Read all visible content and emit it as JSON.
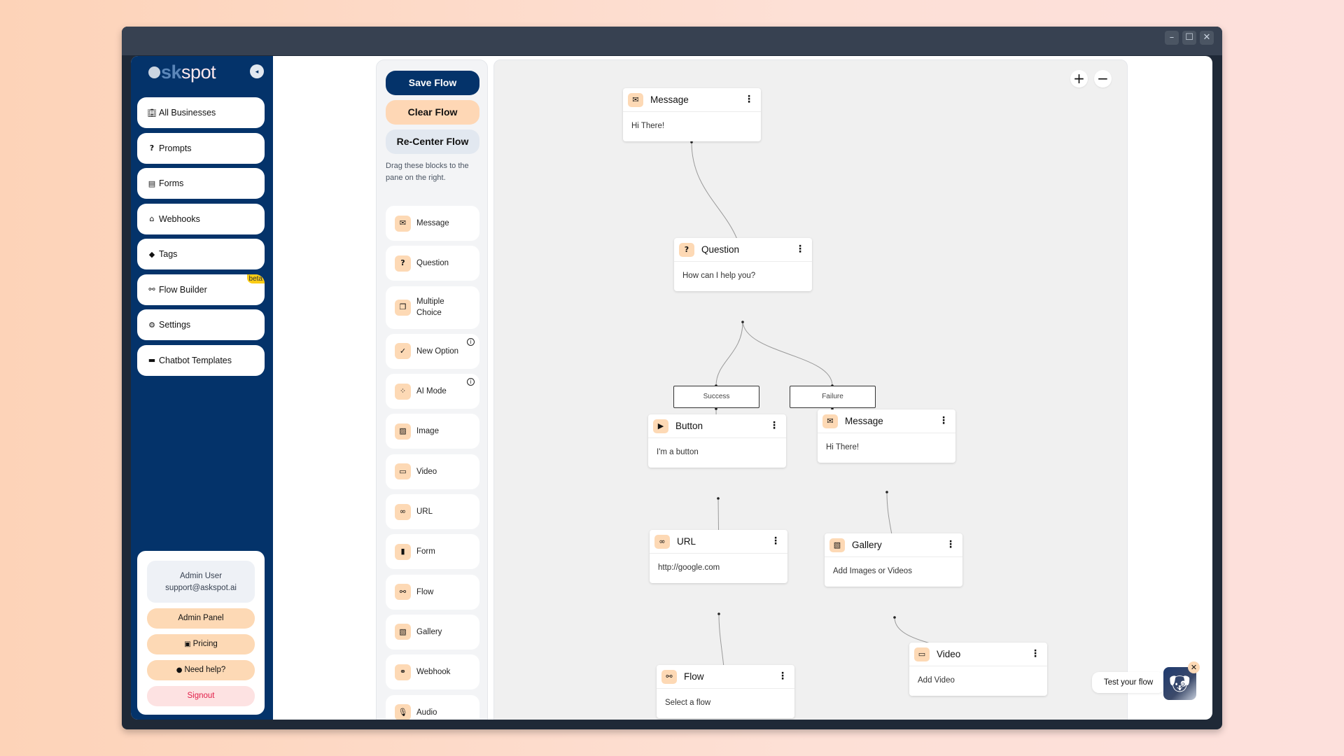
{
  "window": {
    "controls": {
      "minimize": "–",
      "maximize": "☐",
      "close": "✕"
    }
  },
  "sidebar": {
    "logo": {
      "ask": "sk",
      "spot": "spot"
    },
    "collapse_icon": "◂",
    "items": [
      {
        "label": "All Businesses",
        "icon": "🏢︎",
        "icon_name": "businesses-icon"
      },
      {
        "label": "Prompts",
        "icon": "?",
        "icon_name": "question-icon"
      },
      {
        "label": "Forms",
        "icon": "▤",
        "icon_name": "forms-icon"
      },
      {
        "label": "Webhooks",
        "icon": "⌂",
        "icon_name": "webhooks-icon"
      },
      {
        "label": "Tags",
        "icon": "◆",
        "icon_name": "tags-icon"
      },
      {
        "label": "Flow Builder",
        "icon": "⚯",
        "icon_name": "flow-builder-icon",
        "badge": "beta"
      },
      {
        "label": "Settings",
        "icon": "⚙",
        "icon_name": "gear-icon"
      },
      {
        "label": "Chatbot Templates",
        "icon": "▬",
        "icon_name": "templates-icon"
      }
    ],
    "user": {
      "name": "Admin User",
      "email": "support@askspot.ai"
    },
    "card_buttons": {
      "admin_panel": "Admin Panel",
      "pricing": "Pricing",
      "pricing_icon": "▣",
      "help": "Need help?",
      "help_icon": "●",
      "signout": "Signout"
    }
  },
  "blocks_panel": {
    "save": "Save Flow",
    "clear": "Clear Flow",
    "recenter": "Re-Center Flow",
    "hint": "Drag these blocks to the pane on the right.",
    "blocks": [
      {
        "label": "Message",
        "icon": "✉"
      },
      {
        "label": "Question",
        "icon": "?"
      },
      {
        "label": "Multiple Choice",
        "icon": "❐"
      },
      {
        "label": "New Option",
        "icon": "✓",
        "info": "i"
      },
      {
        "label": "AI Mode",
        "icon": "⁘",
        "info": "i"
      },
      {
        "label": "Image",
        "icon": "▨"
      },
      {
        "label": "Video",
        "icon": "▭"
      },
      {
        "label": "URL",
        "icon": "∞"
      },
      {
        "label": "Form",
        "icon": "▮"
      },
      {
        "label": "Flow",
        "icon": "⚯"
      },
      {
        "label": "Gallery",
        "icon": "▧"
      },
      {
        "label": "Webhook",
        "icon": "⚭"
      },
      {
        "label": "Audio",
        "icon": "🎙︎"
      }
    ]
  },
  "canvas": {
    "zoom_in": "+",
    "zoom_out": "−",
    "nodes": [
      {
        "id": "message1",
        "title": "Message",
        "icon": "✉",
        "body": "Hi There!"
      },
      {
        "id": "question1",
        "title": "Question",
        "icon": "?",
        "body": "How can I help you?"
      },
      {
        "id": "button1",
        "title": "Button",
        "icon": "▶",
        "body": "I'm a button"
      },
      {
        "id": "message2",
        "title": "Message",
        "icon": "✉",
        "body": "Hi There!"
      },
      {
        "id": "url1",
        "title": "URL",
        "icon": "∞",
        "body": "http://google.com"
      },
      {
        "id": "gallery1",
        "title": "Gallery",
        "icon": "▧",
        "body": "Add Images or Videos"
      },
      {
        "id": "flow1",
        "title": "Flow",
        "icon": "⚯",
        "body": "Select a flow"
      },
      {
        "id": "video1",
        "title": "Video",
        "icon": "▭",
        "body": "Add Video"
      }
    ],
    "conditions": {
      "success": "Success",
      "failure": "Failure"
    },
    "menu_icon": "⋮"
  },
  "test_widget": {
    "label": "Test your flow",
    "avatar_icon": "🐶︎",
    "close": "✕"
  }
}
